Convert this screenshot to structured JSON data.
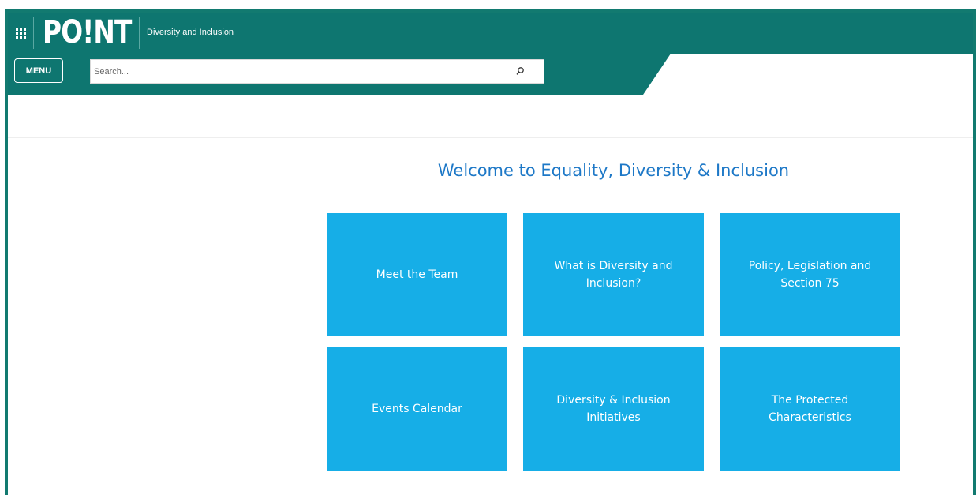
{
  "header": {
    "logo_text": "PO!NT",
    "site_title": "Diversity and Inclusion",
    "menu_label": "MENU",
    "search_placeholder": "Search..."
  },
  "main": {
    "welcome": "Welcome to Equality, Diversity & Inclusion",
    "tiles": [
      {
        "label": "Meet the Team"
      },
      {
        "label": "What is Diversity and Inclusion?"
      },
      {
        "label": "Policy, Legislation and Section 75"
      },
      {
        "label": "Events Calendar"
      },
      {
        "label": "Diversity & Inclusion Initiatives"
      },
      {
        "label": "The Protected Characteristics"
      }
    ]
  },
  "colors": {
    "brand_teal": "#0e7670",
    "tile_blue": "#16aee7",
    "heading_blue": "#1d78c7"
  },
  "icons": {
    "app_launcher": "waffle-icon",
    "search": "search-icon"
  }
}
